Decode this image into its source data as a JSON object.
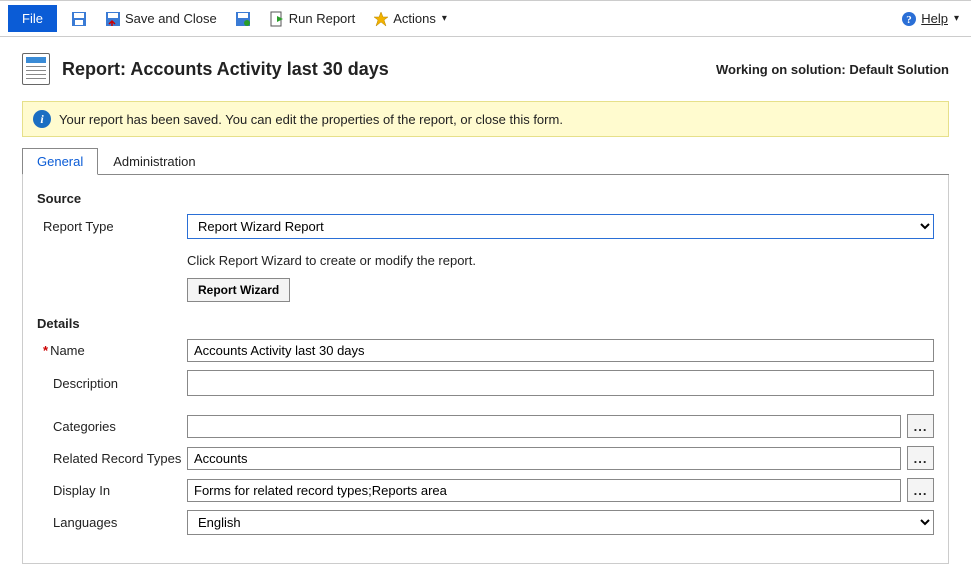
{
  "toolbar": {
    "file": "File",
    "save_close": "Save and Close",
    "run_report": "Run Report",
    "actions": "Actions",
    "help": "Help"
  },
  "header": {
    "title": "Report: Accounts Activity last 30 days",
    "working_prefix": "Working on solution: ",
    "working_solution": "Default Solution"
  },
  "banner": {
    "text": "Your report has been saved. You can edit the properties of the report, or close this form."
  },
  "tabs": {
    "general": "General",
    "administration": "Administration"
  },
  "sections": {
    "source": "Source",
    "details": "Details"
  },
  "fields": {
    "report_type": {
      "label": "Report Type",
      "value": "Report Wizard Report",
      "hint": "Click Report Wizard to create or modify the report.",
      "wizard_button": "Report Wizard"
    },
    "name": {
      "label": "Name",
      "value": "Accounts Activity last 30 days"
    },
    "description": {
      "label": "Description",
      "value": ""
    },
    "categories": {
      "label": "Categories",
      "value": ""
    },
    "related_record_types": {
      "label": "Related Record Types",
      "value": "Accounts"
    },
    "display_in": {
      "label": "Display In",
      "value": "Forms for related record types;Reports area"
    },
    "languages": {
      "label": "Languages",
      "value": "English"
    }
  }
}
